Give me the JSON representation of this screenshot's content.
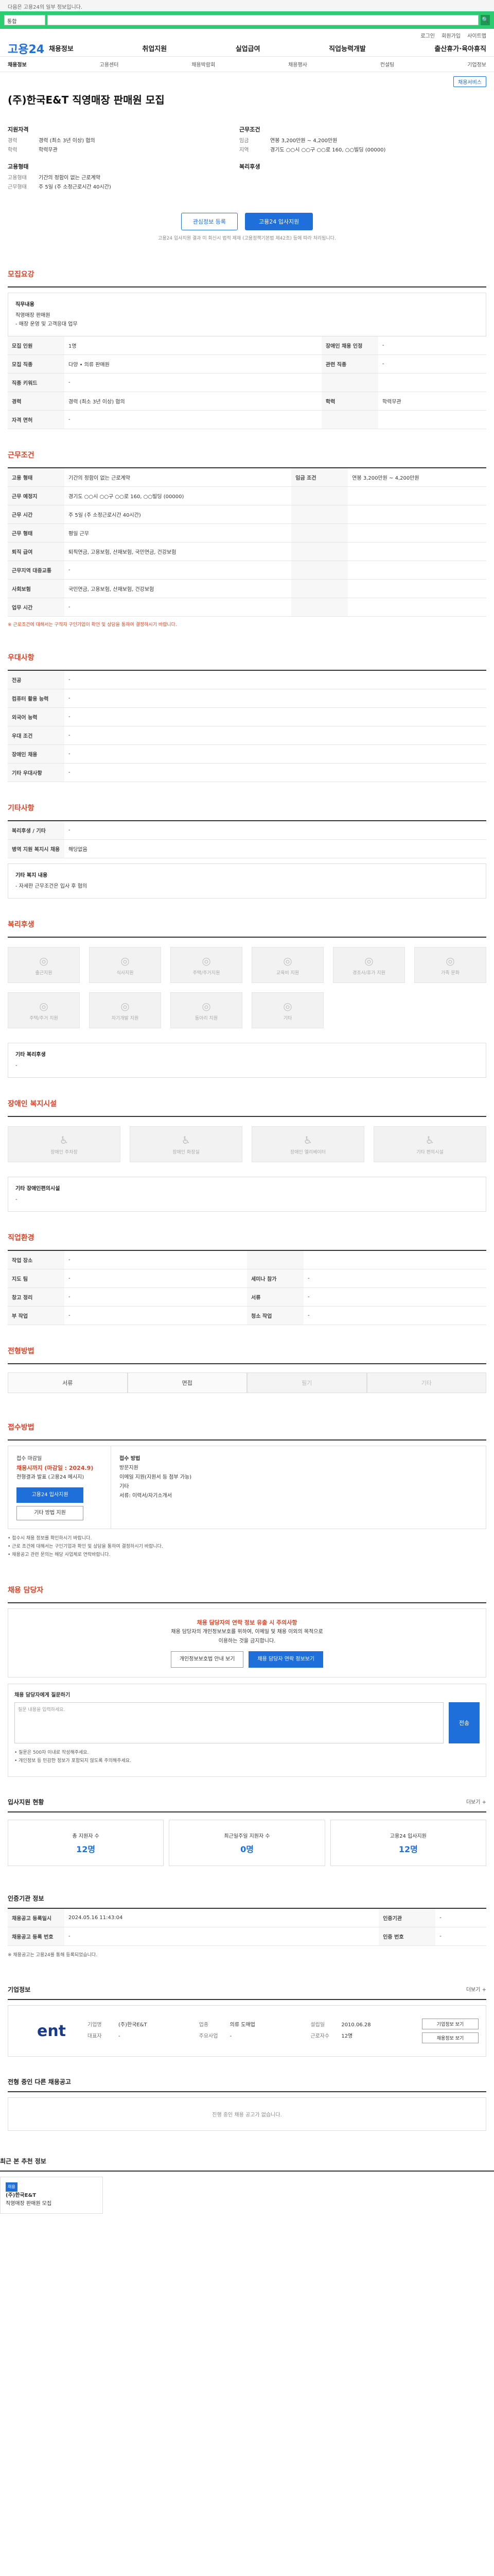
{
  "notice": "다음은 고용24의 일부 정보입니다.",
  "search": {
    "select": "통합",
    "placeholder": "",
    "button": "🔍"
  },
  "login": [
    "로그인",
    "회원가입",
    "사이트맵"
  ],
  "logo": "고용24",
  "mainnav": [
    "채용정보",
    "취업지원",
    "실업급여",
    "직업능력개발",
    "출산휴가·육아휴직"
  ],
  "subnav": [
    {
      "label": "채용정보",
      "on": true
    },
    {
      "label": "고용센터"
    },
    {
      "label": "채용박람회"
    },
    {
      "label": "채용행사"
    },
    {
      "label": "컨설팅"
    },
    {
      "label": "기업정보"
    }
  ],
  "status_btn": "채용서비스",
  "title": "(주)한국E&T 직영매장 판매원 모집",
  "summary": {
    "left_title": "지원자격",
    "left": [
      {
        "k": "경력",
        "v": "경력 (최소 3년 이상) 협의"
      },
      {
        "k": "학력",
        "v": "학력무관"
      }
    ],
    "left_title2": "고용형태",
    "left2": [
      {
        "k": "고용형태",
        "v": "기간의 정함이 없는 근로계약"
      },
      {
        "k": "근무형태",
        "v": "주 5일 (주 소정근로시간 40시간)"
      }
    ],
    "right_title": "근무조건",
    "right": [
      {
        "k": "임금",
        "v": "연봉 3,200만원 ~ 4,200만원"
      },
      {
        "k": "지역",
        "v": "경기도 ○○시 ○○구 ○○로 160, ○○빌딩 (00000)"
      }
    ],
    "right_title2": "복리후생",
    "right2": []
  },
  "actions": {
    "scrap": "관심정보 등록",
    "apply": "고용24 입사지원",
    "note": "고용24 입사지원 결과 미 회신시 법적 제재 (고용정책기본법 제42조) 등에 따라 처리됩니다."
  },
  "sections": {
    "job": "모집요강",
    "cond": "근무조건",
    "pref": "우대사항",
    "etc": "기타사항",
    "welfare": "복리후생",
    "disabled": "장애인 복지시설",
    "near": "직업환경",
    "process": "전형방법",
    "receipt": "접수방법",
    "contact": "채용 담당자",
    "stats": "입사지원 현황",
    "agency": "인증기관 정보",
    "company": "기업정보",
    "other": "전형 중인 다른 채용공고",
    "recent": "최근 본 추천 정보"
  },
  "job_box": {
    "title": "직무내용",
    "lines": [
      "직영매장 판매원",
      "- 매장 운영 및 고객응대 업무"
    ]
  },
  "job_table": [
    [
      "모집 인원",
      "1명",
      "장애인 채용 인정",
      "-"
    ],
    [
      "모집 직종",
      "다양 • 의류 판매원",
      "관련 직종",
      "-"
    ],
    [
      "직종 키워드",
      "-",
      "",
      ""
    ],
    [
      "경력",
      "경력 (최소 3년 이상) 협의",
      "학력",
      "학력무관"
    ],
    [
      "자격 면허",
      "-",
      "",
      ""
    ]
  ],
  "cond_table": [
    [
      "고용 형태",
      "기간의 정함이 없는 근로계약",
      "임금 조건",
      "연봉 3,200만원 ~ 4,200만원"
    ],
    [
      "근무 예정지",
      "경기도 ○○시 ○○구 ○○로 160, ○○빌딩 (00000)",
      "",
      ""
    ],
    [
      "근무 시간",
      "주 5일 (주 소정근로시간 40시간)",
      "",
      ""
    ],
    [
      "근무 형태",
      "평일 근무",
      "",
      ""
    ],
    [
      "퇴직 급여",
      "퇴직연금, 고용보험, 산재보험, 국민연금, 건강보험",
      "",
      ""
    ],
    [
      "근무지역 대중교통",
      "-",
      "",
      ""
    ],
    [
      "사회보험",
      "국민연금, 고용보험, 산재보험, 건강보험",
      "",
      ""
    ],
    [
      "업무 시간",
      "-",
      "",
      ""
    ]
  ],
  "cond_note": "※ 근로조건에 대해서는 구직자 구인기업이 확인 및 상담을 통하여 결정하시기 바랍니다.",
  "pref_table": [
    [
      "전공",
      "-"
    ],
    [
      "컴퓨터 활용 능력",
      "-"
    ],
    [
      "외국어 능력",
      "-"
    ],
    [
      "우대 조건",
      "-"
    ],
    [
      "장애인 채용",
      "-"
    ],
    [
      "기타 우대사항",
      "-"
    ]
  ],
  "etc_table": [
    [
      "복리후생 / 기타",
      "-"
    ],
    [
      "병역 지원 복지시 채용",
      "해당없음"
    ]
  ],
  "etc_box": [
    "기타 복지 내용",
    "- 자세한 근무조건은 입사 후 협의"
  ],
  "welfare": [
    "출근지원",
    "식사지원",
    "주택/주거지원",
    "교육비 지원",
    "경조사/휴가 지원",
    "가족 문화",
    "주택/주거 지원",
    "자기개발 지원",
    "동아리 지원",
    "기타"
  ],
  "welfare_box": "기타 복리후생",
  "disabled": [
    "장애인 주차장",
    "장애인 화장실",
    "장애인 엘리베이터",
    "기타 편의시설"
  ],
  "disabled_box": "기타 장애인편의시설",
  "near_table": [
    [
      "작업 장소",
      "-",
      "",
      ""
    ],
    [
      "지도 팀",
      "-",
      "세미나 참가",
      "-"
    ],
    [
      "창고 정리",
      "-",
      "서류",
      "-"
    ],
    [
      "부 작업",
      "-",
      "청소 작업",
      "-"
    ]
  ],
  "process_tabs": [
    {
      "t": "서류"
    },
    {
      "t": "면접"
    },
    {
      "t": "필기",
      "dis": true
    },
    {
      "t": "기타",
      "dis": true
    }
  ],
  "receipt": {
    "l_title": "접수 마감일",
    "deadline": "채용시까지 (마감일 : 2024.9)",
    "l_sub": "전형결과 발표 (고용24 메시지)",
    "apply": "고용24 입사지원",
    "more": "기타 방법 지원",
    "r_title": "접수 방법",
    "r_lines": [
      "방문지원",
      "이메일 지원(지원서 등 첨부 가능)",
      "기타",
      "서류: 이력서/자기소개서"
    ]
  },
  "receipt_notes": [
    "• 접수시 채용 정보를 확인하시기 바랍니다.",
    "• 근로 조건에 대해서는 구인기업과 확인 및 상담을 통하여 결정하시기 바랍니다.",
    "• 채용공고 관련 문의는 해당 사업체로 연락바랍니다."
  ],
  "contact": {
    "warn": "채용 담당자의 연락 정보 유출 시 주의사항",
    "lines": [
      "채용 담당자의 개인정보보호를 위하여, 이메일 및 채용 이외의 목적으로",
      "이용하는 것을 금지합니다."
    ],
    "b1": "개인정보보호법 안내 보기",
    "b2": "채용 담당자 연락 정보보기"
  },
  "question": {
    "title": "채용 담당자에게 질문하기",
    "placeholder": "질문 내용을 입력하세요.",
    "send": "전송"
  },
  "question_notes": [
    "• 질문은 500자 이내로 작성해주세요.",
    "• 개인정보 등 민감한 정보가 포함되지 않도록 주의해주세요."
  ],
  "stats": [
    {
      "label": "총 지원자 수",
      "n": "12명"
    },
    {
      "label": "최근일주일 지원자 수",
      "n": "0명"
    },
    {
      "label": "고용24 입사지원",
      "n": "12명"
    }
  ],
  "agency_table": [
    [
      "채용공고 등록일시",
      "2024.05.16 11:43:04",
      "인증기관",
      "-"
    ],
    [
      "채용공고 등록 번호",
      "-",
      "인증 번호",
      "-"
    ]
  ],
  "agency_note": "※ 채용공고는 고용24를 통해 등록되었습니다.",
  "company": {
    "logo": "ent",
    "meta": [
      [
        "기업명",
        "(주)한국E&T"
      ],
      [
        "업종",
        "의류 도매업"
      ],
      [
        "설립일",
        "2010.06.28"
      ],
      [
        "대표자",
        "-"
      ],
      [
        "주요사업",
        "-"
      ],
      [
        "근로자수",
        "12명"
      ]
    ],
    "side": [
      "기업정보 보기",
      "채용정보 보기"
    ]
  },
  "other_empty": "진행 중인 채용 공고가 없습니다.",
  "recent": {
    "badge": "채용",
    "name": "(주)한국E&T",
    "line": "직영매장 판매원 모집"
  },
  "more": "더보기 +"
}
